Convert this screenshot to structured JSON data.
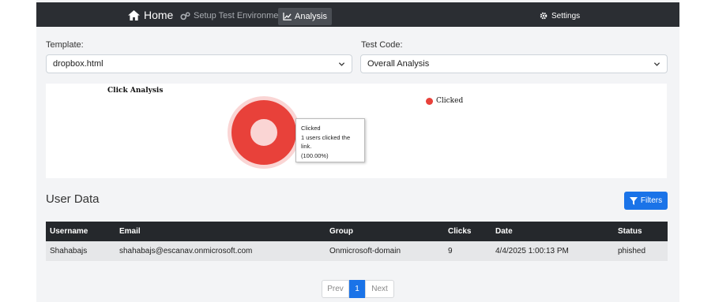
{
  "nav": {
    "home_label": "Home",
    "setup_label": "Setup Test Environment",
    "analysis_label": "Analysis",
    "settings_label": "Settings"
  },
  "form": {
    "template_label": "Template:",
    "template_value": "dropbox.html",
    "test_code_label": "Test Code:",
    "test_code_value": "Overall Analysis"
  },
  "chart_data": {
    "type": "pie",
    "title": "Click Analysis",
    "categories": [
      "Clicked"
    ],
    "values": [
      1
    ],
    "colors": [
      "#e8413a"
    ],
    "legend_position": "top-right",
    "tooltip": {
      "title": "Clicked",
      "line1": "1 users clicked the link.",
      "line2": "(100.00%)"
    }
  },
  "user_data": {
    "title": "User Data",
    "filters_label": "Filters",
    "columns": [
      "Username",
      "Email",
      "Group",
      "Clicks",
      "Date",
      "Status"
    ],
    "rows": [
      [
        "Shahabajs",
        "shahabajs@escanav.onmicrosoft.com",
        "Onmicrosoft-domain",
        "9",
        "4/4/2025 1:00:13 PM",
        "phished"
      ]
    ]
  },
  "pagination": {
    "prev_label": "Prev",
    "current_page": "1",
    "next_label": "Next"
  },
  "colors": {
    "navbar": "#2b2e33",
    "accent": "#1a73e8",
    "clicked": "#e8413a"
  }
}
